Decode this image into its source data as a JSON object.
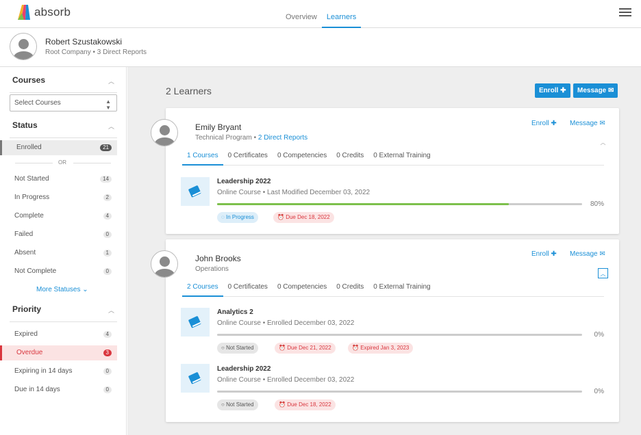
{
  "app": {
    "name": "absorb",
    "colors": {
      "accent": "#1a8fd6",
      "progress": "#7cc04b",
      "danger": "#d9363e"
    }
  },
  "nav": {
    "tabs": [
      {
        "label": "Overview",
        "active": false
      },
      {
        "label": "Learners",
        "active": true
      }
    ]
  },
  "user": {
    "name": "Robert Szustakowski",
    "sub": "Root Company  •  3 Direct Reports"
  },
  "sidebar": {
    "courses": {
      "title": "Courses",
      "select": "Select Courses"
    },
    "status": {
      "title": "Status",
      "enrolled": {
        "label": "Enrolled",
        "count": "21"
      },
      "or": "OR",
      "items": [
        {
          "label": "Not Started",
          "count": "14"
        },
        {
          "label": "In Progress",
          "count": "2"
        },
        {
          "label": "Complete",
          "count": "4"
        },
        {
          "label": "Failed",
          "count": "0"
        },
        {
          "label": "Absent",
          "count": "1"
        },
        {
          "label": "Not Complete",
          "count": "0"
        }
      ],
      "more": "More Statuses"
    },
    "priority": {
      "title": "Priority",
      "items": [
        {
          "label": "Expired",
          "count": "4"
        },
        {
          "label": "Overdue",
          "count": "3"
        },
        {
          "label": "Expiring in 14 days",
          "count": "0"
        },
        {
          "label": "Due in 14 days",
          "count": "0"
        }
      ]
    }
  },
  "main": {
    "title": "2 Learners",
    "enroll": "Enroll ✚",
    "message": "Message ✉",
    "learners": [
      {
        "name": "Emily Bryant",
        "sub": "Technical Program  • ",
        "link": "2 Direct Reports",
        "enroll": "Enroll ✚",
        "message": "Message ✉",
        "tabs": [
          "1 Courses",
          "0 Certificates",
          "0 Competencies",
          "0 Credits",
          "0 External Training"
        ],
        "courses": [
          {
            "title": "Leadership 2022",
            "meta": "Online Course  •  Last Modified December 03, 2022",
            "progress": 80,
            "pct": "80%",
            "pills": [
              {
                "type": "prog",
                "label": "In Progress",
                "icon": "spinner-icon"
              },
              {
                "type": "due",
                "label": "Due Dec 18, 2022",
                "icon": "alarm-icon"
              }
            ]
          }
        ]
      },
      {
        "name": "John Brooks",
        "sub": "Operations",
        "enroll": "Enroll ✚",
        "message": "Message ✉",
        "tabs": [
          "2 Courses",
          "0 Certificates",
          "0 Competencies",
          "0 Credits",
          "0 External Training"
        ],
        "courses": [
          {
            "title": "Analytics 2",
            "meta": "Online Course  •  Enrolled December 03, 2022",
            "progress": 0,
            "pct": "0%",
            "pills": [
              {
                "type": "ns",
                "label": "Not Started",
                "icon": "circle-icon"
              },
              {
                "type": "due",
                "label": "Due Dec 21, 2022",
                "icon": "alarm-icon"
              },
              {
                "type": "due",
                "label": "Expired Jan 3, 2023",
                "icon": "alarm-icon"
              }
            ]
          },
          {
            "title": "Leadership 2022",
            "meta": "Online Course  •  Enrolled December 03, 2022",
            "progress": 0,
            "pct": "0%",
            "pills": [
              {
                "type": "ns",
                "label": "Not Started",
                "icon": "circle-icon"
              },
              {
                "type": "due",
                "label": "Due Dec 18, 2022",
                "icon": "alarm-icon"
              }
            ]
          }
        ]
      }
    ]
  }
}
